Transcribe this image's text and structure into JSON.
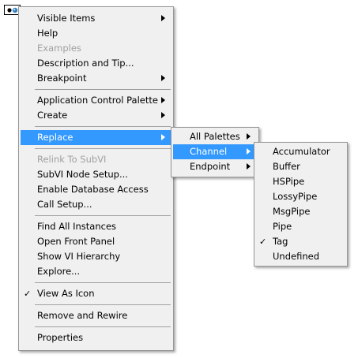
{
  "menus": {
    "context": {
      "items": [
        {
          "label": "Visible Items"
        },
        {
          "label": "Help"
        },
        {
          "label": "Examples"
        },
        {
          "label": "Description and Tip..."
        },
        {
          "label": "Breakpoint"
        },
        {
          "label": "Application Control Palette"
        },
        {
          "label": "Create"
        },
        {
          "label": "Replace"
        },
        {
          "label": "Relink To SubVI"
        },
        {
          "label": "SubVI Node Setup..."
        },
        {
          "label": "Enable Database Access"
        },
        {
          "label": "Call Setup..."
        },
        {
          "label": "Find All Instances"
        },
        {
          "label": "Open Front Panel"
        },
        {
          "label": "Show VI Hierarchy"
        },
        {
          "label": "Explore..."
        },
        {
          "label": "View As Icon",
          "check": "✓"
        },
        {
          "label": "Remove and Rewire"
        },
        {
          "label": "Properties"
        }
      ]
    },
    "replace": {
      "items": [
        {
          "label": "All Palettes"
        },
        {
          "label": "Channel"
        },
        {
          "label": "Endpoint"
        }
      ]
    },
    "channel": {
      "items": [
        {
          "label": "Accumulator"
        },
        {
          "label": "Buffer"
        },
        {
          "label": "HSPipe"
        },
        {
          "label": "LossyPipe"
        },
        {
          "label": "MsgPipe"
        },
        {
          "label": "Pipe"
        },
        {
          "label": "Tag",
          "check": "✓"
        },
        {
          "label": "Undefined"
        }
      ]
    }
  },
  "colors": {
    "menu_bg": "#f0f0f0",
    "selection": "#3399ff",
    "disabled_text": "#a0a0a0"
  }
}
